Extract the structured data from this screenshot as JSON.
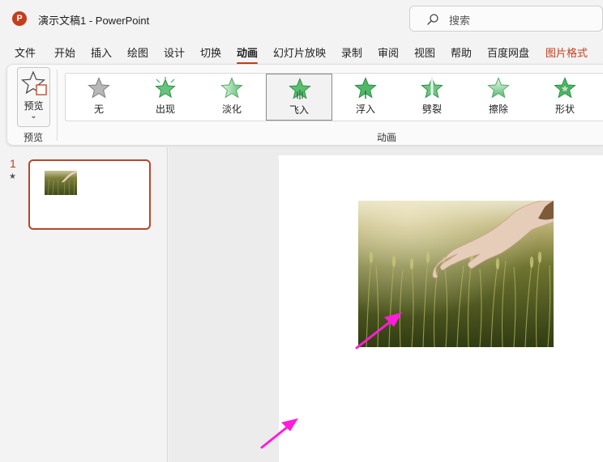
{
  "titlebar": {
    "app_icon_letter": "P",
    "title": "演示文稿1  -  PowerPoint",
    "search_placeholder": "搜索"
  },
  "menu": {
    "items": [
      "文件",
      "开始",
      "插入",
      "绘图",
      "设计",
      "切换",
      "动画",
      "幻灯片放映",
      "录制",
      "审阅",
      "视图",
      "帮助",
      "百度网盘",
      "图片格式"
    ],
    "active": "动画",
    "contextual": "图片格式"
  },
  "ribbon": {
    "preview_label": "预览",
    "preview_group_label": "预览",
    "animation_group_label": "动画",
    "animations": [
      {
        "label": "无",
        "icon": "none-star-icon",
        "selected": false
      },
      {
        "label": "出现",
        "icon": "appear-star-icon",
        "selected": false
      },
      {
        "label": "淡化",
        "icon": "fade-star-icon",
        "selected": false
      },
      {
        "label": "飞入",
        "icon": "fly-in-star-icon",
        "selected": true
      },
      {
        "label": "浮入",
        "icon": "float-in-star-icon",
        "selected": false
      },
      {
        "label": "劈裂",
        "icon": "split-star-icon",
        "selected": false
      },
      {
        "label": "擦除",
        "icon": "wipe-star-icon",
        "selected": false
      },
      {
        "label": "形状",
        "icon": "shape-star-icon",
        "selected": false
      }
    ]
  },
  "thumbnails": {
    "slide_number": "1",
    "animation_marker": "★"
  },
  "colors": {
    "accent": "#c43e1c",
    "star_green": "#3fae5a",
    "annotation_arrow": "#ff1dd8"
  }
}
